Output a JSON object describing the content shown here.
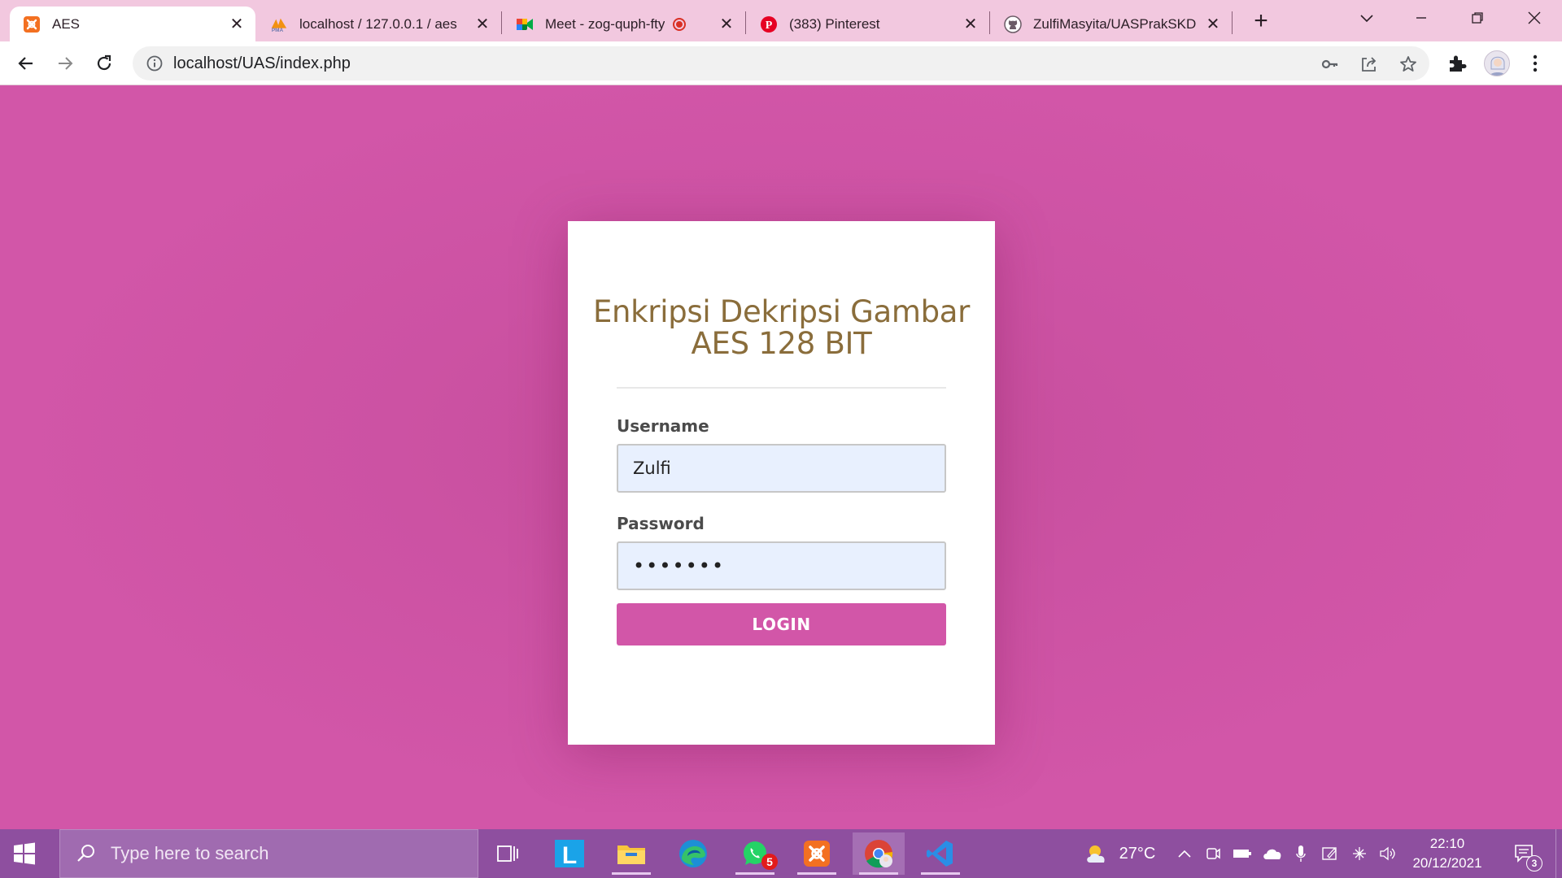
{
  "browser": {
    "tabs": [
      {
        "title": "AES",
        "favicon": "xampp-icon",
        "active": true
      },
      {
        "title": "localhost / 127.0.0.1 / aes",
        "favicon": "phpmyadmin-icon",
        "active": false
      },
      {
        "title": "Meet - zog-quph-fty",
        "favicon": "google-meet-icon",
        "active": false,
        "recording": true
      },
      {
        "title": "(383) Pinterest",
        "favicon": "pinterest-icon",
        "active": false
      },
      {
        "title": "ZulfiMasyita/UASPrakSKD",
        "favicon": "github-icon",
        "active": false
      }
    ],
    "url": "localhost/UAS/index.php"
  },
  "login": {
    "title_line1": "Enkripsi Dekripsi Gambar",
    "title_line2": "AES 128 BIT",
    "username_label": "Username",
    "username_value": "Zulfi",
    "password_label": "Password",
    "password_value": "•••••••",
    "login_button": "LOGIN"
  },
  "taskbar": {
    "search_placeholder": "Type here to search",
    "whatsapp_badge": "5",
    "weather_temp": "27°C",
    "time": "22:10",
    "date": "20/12/2021",
    "notification_count": "3"
  },
  "colors": {
    "page_background": "#d256a8",
    "title_color": "#8a6d3b",
    "button_color": "#d256a8",
    "taskbar": "#8e4f9f"
  }
}
